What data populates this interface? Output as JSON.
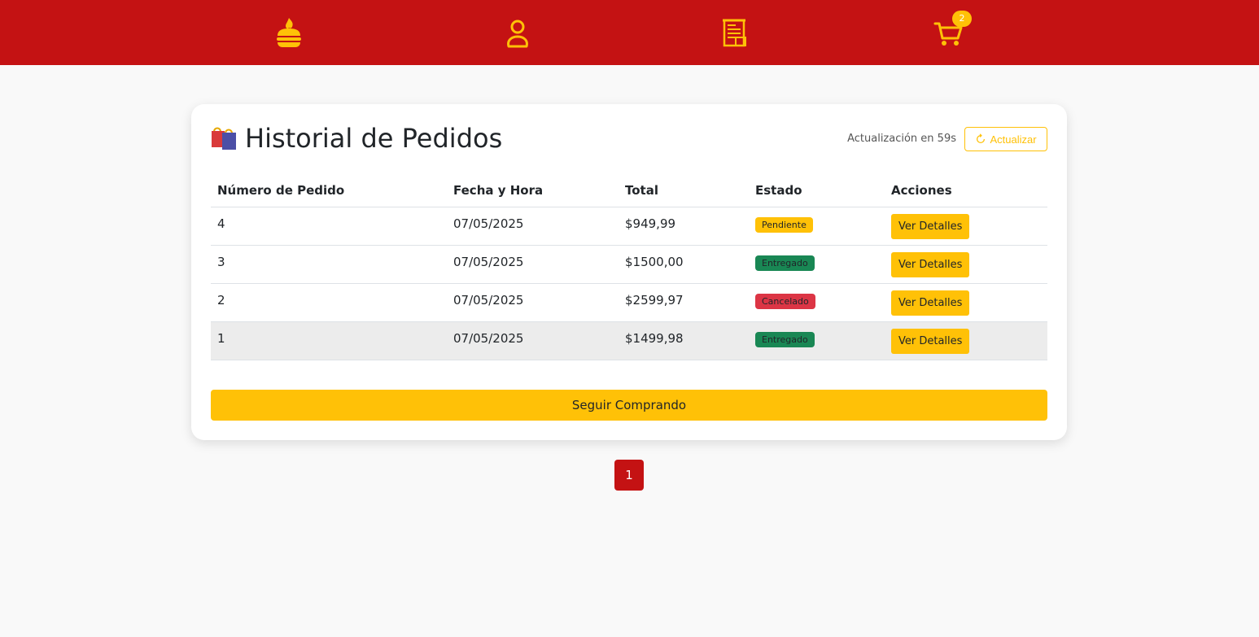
{
  "nav": {
    "items": [
      {
        "icon": "burger-icon"
      },
      {
        "icon": "user-icon"
      },
      {
        "icon": "receipt-icon"
      },
      {
        "icon": "cart-icon"
      }
    ],
    "cart_badge": "2"
  },
  "header": {
    "title": "Historial de Pedidos",
    "countdown": "Actualización en 59s",
    "refresh_label": "Actualizar"
  },
  "table": {
    "columns": [
      "Número de Pedido",
      "Fecha y Hora",
      "Total",
      "Estado",
      "Acciones"
    ],
    "rows": [
      {
        "number": "4",
        "date": "07/05/2025",
        "total": "$949,99",
        "status": "Pendiente",
        "action": "Ver Detalles"
      },
      {
        "number": "3",
        "date": "07/05/2025",
        "total": "$1500,00",
        "status": "Entregado",
        "action": "Ver Detalles"
      },
      {
        "number": "2",
        "date": "07/05/2025",
        "total": "$2599,97",
        "status": "Cancelado",
        "action": "Ver Detalles"
      },
      {
        "number": "1",
        "date": "07/05/2025",
        "total": "$1499,98",
        "status": "Entregado",
        "action": "Ver Detalles"
      }
    ]
  },
  "continue_label": "Seguir Comprando",
  "pagination": {
    "current": "1"
  },
  "colors": {
    "brand_red": "#c41213",
    "accent_yellow": "#ffc107",
    "status_pending": "#ffc107",
    "status_delivered": "#198754",
    "status_cancelled": "#dc3545"
  }
}
